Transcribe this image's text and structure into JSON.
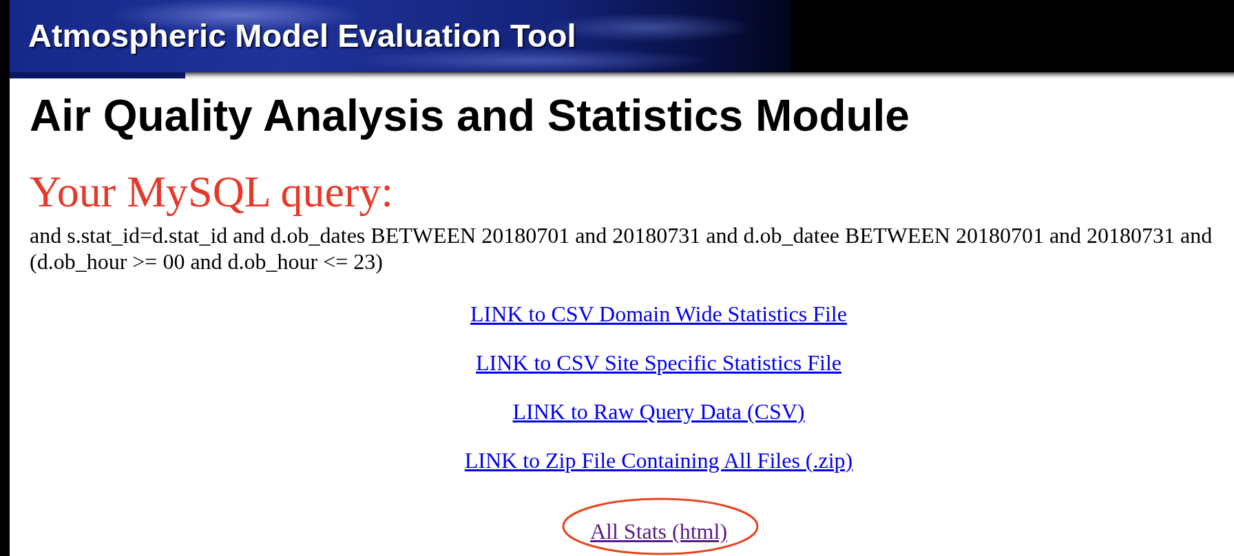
{
  "banner": {
    "title": "Atmospheric Model Evaluation Tool"
  },
  "page_title": "Air Quality Analysis and Statistics Module",
  "query": {
    "heading": "Your MySQL query:",
    "text": "and s.stat_id=d.stat_id and d.ob_dates BETWEEN 20180701 and 20180731 and d.ob_datee BETWEEN 20180701 and 20180731 and (d.ob_hour >= 00 and d.ob_hour <= 23)"
  },
  "links": [
    {
      "label": "LINK to CSV Domain Wide Statistics File",
      "visited": false
    },
    {
      "label": "LINK to CSV Site Specific Statistics File",
      "visited": false
    },
    {
      "label": "LINK to Raw Query Data (CSV)",
      "visited": false
    },
    {
      "label": "LINK to Zip File Containing All Files (.zip)",
      "visited": false
    }
  ],
  "stats_link": {
    "label": "All Stats (html)",
    "visited": true,
    "circled": true
  }
}
